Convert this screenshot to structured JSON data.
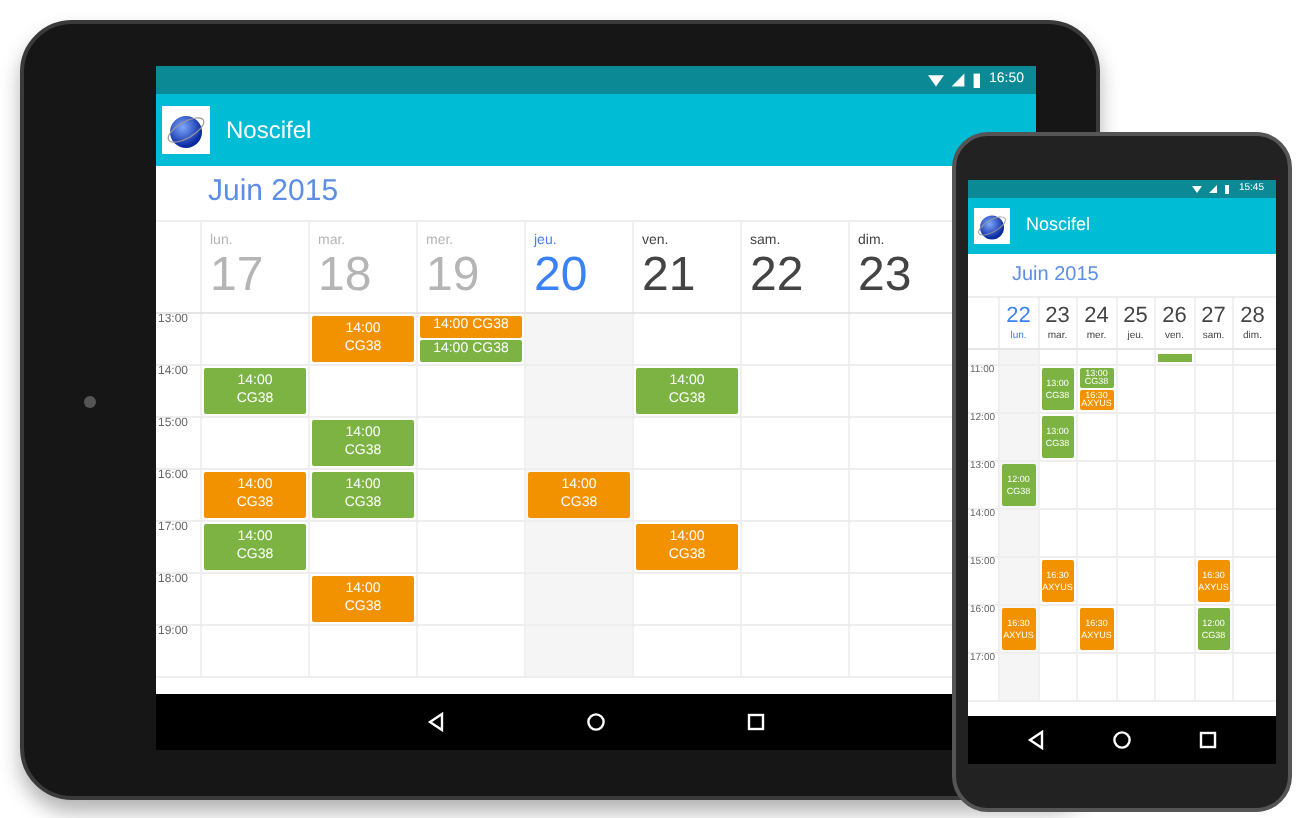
{
  "devices": [
    {
      "kind": "tablet",
      "status_time": "16:50",
      "app_title": "Noscifel",
      "month": "Juin 2015",
      "days": [
        {
          "name": "lun.",
          "number": "17",
          "selected": false,
          "past": true
        },
        {
          "name": "mar.",
          "number": "18",
          "selected": false,
          "past": true
        },
        {
          "name": "mer.",
          "number": "19",
          "selected": false,
          "past": true
        },
        {
          "name": "jeu.",
          "number": "20",
          "selected": true,
          "past": false
        },
        {
          "name": "ven.",
          "number": "21",
          "selected": false,
          "past": false
        },
        {
          "name": "sam.",
          "number": "22",
          "selected": false,
          "past": false
        },
        {
          "name": "dim.",
          "number": "23",
          "selected": false,
          "past": false
        }
      ],
      "hours": [
        {
          "label": "13:00",
          "cells": [
            [],
            [
              {
                "time": "14:00",
                "title": "CG38",
                "color": "#f39200"
              }
            ],
            [
              {
                "time": "14:00",
                "title": "CG38",
                "color": "#f39200"
              },
              {
                "time": "14:00",
                "title": "CG38",
                "color": "#7cb342"
              }
            ],
            [],
            [],
            [],
            []
          ]
        },
        {
          "label": "14:00",
          "cells": [
            [
              {
                "time": "14:00",
                "title": "CG38",
                "color": "#7cb342"
              }
            ],
            [],
            [],
            [],
            [
              {
                "time": "14:00",
                "title": "CG38",
                "color": "#7cb342"
              }
            ],
            [],
            []
          ]
        },
        {
          "label": "15:00",
          "cells": [
            [],
            [
              {
                "time": "14:00",
                "title": "CG38",
                "color": "#7cb342"
              }
            ],
            [],
            [],
            [],
            [],
            []
          ]
        },
        {
          "label": "16:00",
          "cells": [
            [
              {
                "time": "14:00",
                "title": "CG38",
                "color": "#f39200"
              }
            ],
            [
              {
                "time": "14:00",
                "title": "CG38",
                "color": "#7cb342"
              }
            ],
            [],
            [
              {
                "time": "14:00",
                "title": "CG38",
                "color": "#f39200"
              }
            ],
            [],
            [],
            []
          ]
        },
        {
          "label": "17:00",
          "cells": [
            [
              {
                "time": "14:00",
                "title": "CG38",
                "color": "#7cb342"
              }
            ],
            [],
            [],
            [],
            [
              {
                "time": "14:00",
                "title": "CG38",
                "color": "#f39200"
              }
            ],
            [],
            []
          ]
        },
        {
          "label": "18:00",
          "cells": [
            [],
            [
              {
                "time": "14:00",
                "title": "CG38",
                "color": "#f39200"
              }
            ],
            [],
            [],
            [],
            [],
            []
          ]
        },
        {
          "label": "19:00",
          "cells": [
            [],
            [],
            [],
            [],
            [],
            [],
            []
          ]
        }
      ]
    },
    {
      "kind": "phone",
      "status_time": "15:45",
      "app_title": "Noscifel",
      "month": "Juin 2015",
      "days": [
        {
          "name": "lun.",
          "number": "22",
          "selected": true,
          "past": false
        },
        {
          "name": "mar.",
          "number": "23",
          "selected": false,
          "past": false
        },
        {
          "name": "mer.",
          "number": "24",
          "selected": false,
          "past": false
        },
        {
          "name": "jeu.",
          "number": "25",
          "selected": false,
          "past": false
        },
        {
          "name": "ven.",
          "number": "26",
          "selected": false,
          "past": false
        },
        {
          "name": "sam.",
          "number": "27",
          "selected": false,
          "past": false
        },
        {
          "name": "dim.",
          "number": "28",
          "selected": false,
          "past": false
        }
      ],
      "hours": [
        {
          "kind": "partial",
          "cells": [
            [],
            [],
            [],
            [],
            [
              {
                "color": "#7cb342"
              }
            ],
            [],
            []
          ]
        },
        {
          "label": "11:00",
          "cells": [
            [],
            [
              {
                "time": "13:00",
                "title": "CG38",
                "color": "#7cb342"
              }
            ],
            [
              {
                "time": "13:00",
                "title": "CG38",
                "color": "#7cb342"
              },
              {
                "time": "16:30",
                "title": "AXYUS",
                "color": "#f39200"
              }
            ],
            [],
            [],
            [],
            []
          ]
        },
        {
          "label": "12:00",
          "cells": [
            [],
            [
              {
                "time": "13:00",
                "title": "CG38",
                "color": "#7cb342"
              }
            ],
            [],
            [],
            [],
            [],
            []
          ]
        },
        {
          "label": "13:00",
          "cells": [
            [
              {
                "time": "12:00",
                "title": "CG38",
                "color": "#7cb342"
              }
            ],
            [],
            [],
            [],
            [],
            [],
            []
          ]
        },
        {
          "label": "14:00",
          "cells": [
            [],
            [],
            [],
            [],
            [],
            [],
            []
          ]
        },
        {
          "label": "15:00",
          "cells": [
            [],
            [
              {
                "time": "16:30",
                "title": "AXYUS",
                "color": "#f39200"
              }
            ],
            [],
            [],
            [],
            [
              {
                "time": "16:30",
                "title": "AXYUS",
                "color": "#f39200"
              }
            ],
            []
          ]
        },
        {
          "label": "16:00",
          "cells": [
            [
              {
                "time": "16:30",
                "title": "AXYUS",
                "color": "#f39200"
              }
            ],
            [],
            [
              {
                "time": "16:30",
                "title": "AXYUS",
                "color": "#f39200"
              }
            ],
            [],
            [],
            [
              {
                "time": "12:00",
                "title": "CG38",
                "color": "#7cb342"
              }
            ],
            []
          ]
        },
        {
          "label": "17:00",
          "cells": [
            [],
            [],
            [],
            [],
            [],
            [],
            []
          ]
        }
      ]
    }
  ]
}
